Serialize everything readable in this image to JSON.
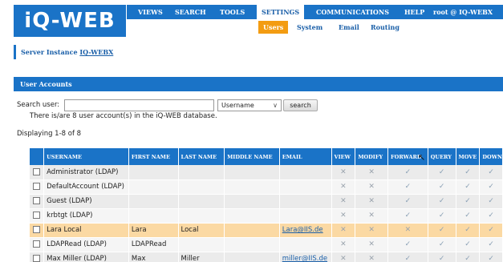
{
  "header": {
    "logo": "iQ-WEB",
    "nav": [
      "VIEWS",
      "SEARCH",
      "TOOLS",
      "SETTINGS",
      "COMMUNICATIONS",
      "HELP",
      "root @ IQ-WEBX"
    ],
    "active_nav": "SETTINGS",
    "subnav": [
      "Users",
      "System",
      "Email",
      "Routing"
    ],
    "active_subnav": "Users"
  },
  "server": {
    "label": "Server Instance",
    "name": "IQ-WEBX"
  },
  "section_title": "User Accounts",
  "search": {
    "label": "Search user:",
    "value": "",
    "field_selected": "Username",
    "button": "search"
  },
  "info_text": "There is/are 8 user account(s) in the iQ-WEB database.",
  "display_text": "Displaying 1-8 of 8",
  "table": {
    "columns": [
      "USERNAME",
      "FIRST NAME",
      "LAST NAME",
      "MIDDLE NAME",
      "EMAIL",
      "VIEW",
      "MODIFY",
      "FORWARD",
      "QUERY",
      "MOVE",
      "DOWN"
    ],
    "rows": [
      {
        "username": "Administrator (LDAP)",
        "first": "",
        "last": "",
        "middle": "",
        "email": "",
        "perms": [
          "x",
          "x",
          "check",
          "check",
          "check",
          "check"
        ]
      },
      {
        "username": "DefaultAccount (LDAP)",
        "first": "",
        "last": "",
        "middle": "",
        "email": "",
        "perms": [
          "x",
          "x",
          "check",
          "check",
          "check",
          "check"
        ]
      },
      {
        "username": "Guest (LDAP)",
        "first": "",
        "last": "",
        "middle": "",
        "email": "",
        "perms": [
          "x",
          "x",
          "check",
          "check",
          "check",
          "check"
        ]
      },
      {
        "username": "krbtgt (LDAP)",
        "first": "",
        "last": "",
        "middle": "",
        "email": "",
        "perms": [
          "x",
          "x",
          "check",
          "check",
          "check",
          "check"
        ]
      },
      {
        "username": "Lara Local",
        "first": "Lara",
        "last": "Local",
        "middle": "",
        "email": "Lara@IIS.de",
        "perms": [
          "x",
          "x",
          "x",
          "check",
          "check",
          "check"
        ]
      },
      {
        "username": "LDAPRead (LDAP)",
        "first": "LDAPRead",
        "last": "",
        "middle": "",
        "email": "",
        "perms": [
          "x",
          "x",
          "check",
          "check",
          "check",
          "check"
        ]
      },
      {
        "username": "Max Miller (LDAP)",
        "first": "Max",
        "last": "Miller",
        "middle": "",
        "email": "miller@IIS.de",
        "perms": [
          "x",
          "x",
          "check",
          "check",
          "check",
          "check"
        ]
      }
    ]
  },
  "colors": {
    "brand_blue": "#1a73c7",
    "active_orange": "#f39c12",
    "highlight_row": "#fbd9a3"
  }
}
